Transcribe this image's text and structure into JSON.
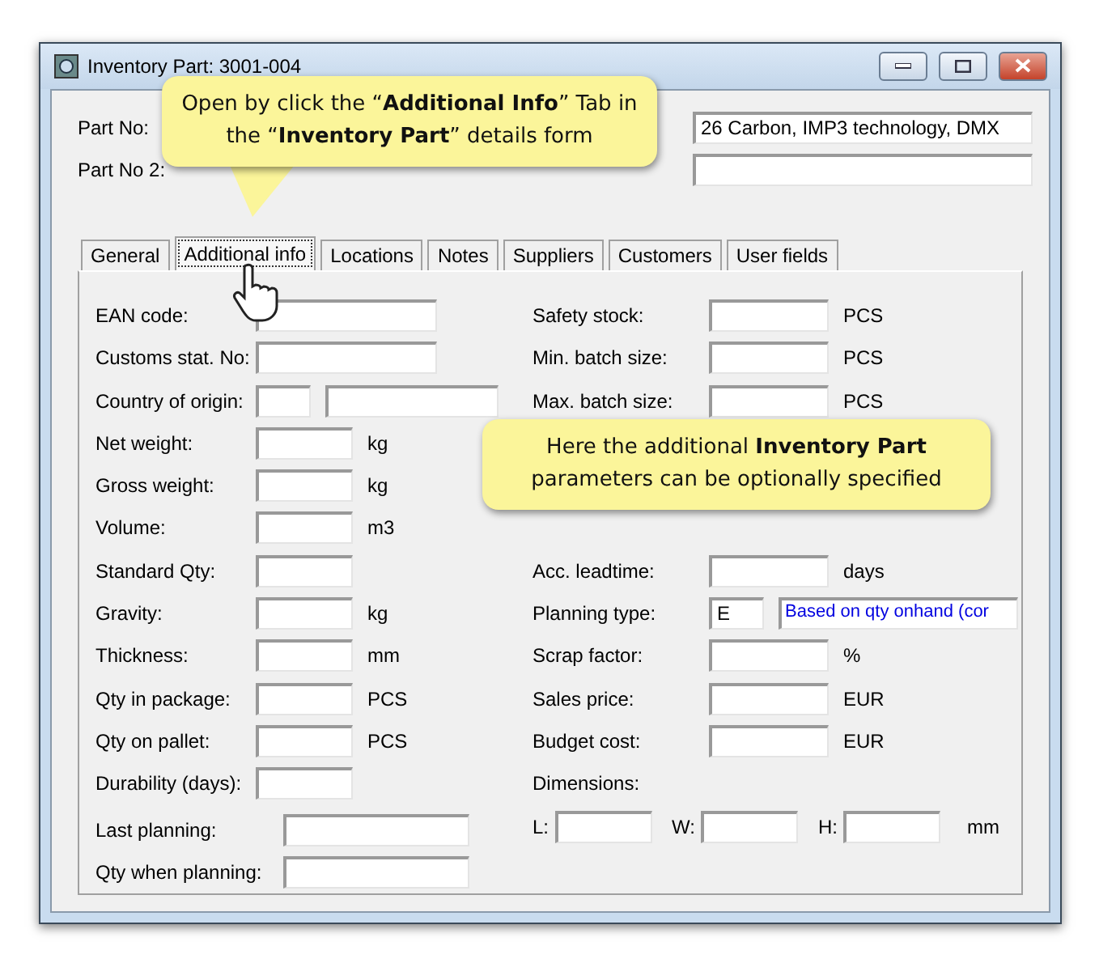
{
  "window": {
    "title": "Inventory Part: 3001-004"
  },
  "header_fields": [
    {
      "label": "Part No:",
      "value": "26 Carbon, IMP3 technology, DMX"
    },
    {
      "label": "Part No 2:"
    }
  ],
  "tabs": [
    {
      "label": "General",
      "selected": false
    },
    {
      "label": "Additional info",
      "selected": true
    },
    {
      "label": "Locations",
      "selected": false
    },
    {
      "label": "Notes",
      "selected": false
    },
    {
      "label": "Suppliers",
      "selected": false
    },
    {
      "label": "Customers",
      "selected": false
    },
    {
      "label": "User fields",
      "selected": false
    }
  ],
  "left_fields": [
    {
      "label": "EAN code:",
      "kind": "long"
    },
    {
      "label": "Customs stat. No:",
      "kind": "long"
    },
    {
      "label": "Country of origin:",
      "kind": "pair"
    },
    {
      "label": "Net weight:",
      "kind": "short",
      "unit": "kg"
    },
    {
      "label": "Gross weight:",
      "kind": "short",
      "unit": "kg"
    },
    {
      "label": "Volume:",
      "kind": "short",
      "unit": "m3"
    },
    {
      "label": "Standard Qty:",
      "kind": "short"
    },
    {
      "label": "Gravity:",
      "kind": "short",
      "unit": "kg"
    },
    {
      "label": "Thickness:",
      "kind": "short",
      "unit": "mm"
    },
    {
      "label": "Qty in package:",
      "kind": "short",
      "unit": "PCS"
    },
    {
      "label": "Qty on pallet:",
      "kind": "short",
      "unit": "PCS"
    },
    {
      "label": "Durability (days):",
      "kind": "short"
    },
    {
      "label": "Last planning:",
      "kind": "wide"
    },
    {
      "label": "Qty when planning:",
      "kind": "wide"
    }
  ],
  "right_fields": [
    {
      "label": "Safety stock:",
      "kind": "short",
      "unit": "PCS"
    },
    {
      "label": "Min. batch size:",
      "kind": "short",
      "unit": "PCS"
    },
    {
      "label": "Max. batch size:",
      "kind": "short",
      "unit": "PCS"
    },
    {
      "label": "Acc. leadtime:",
      "kind": "short",
      "unit": "days"
    },
    {
      "label": "Planning type:",
      "kind": "code",
      "value": "E",
      "description": "Based on qty onhand (cor"
    },
    {
      "label": "Scrap factor:",
      "kind": "short",
      "unit": "%"
    },
    {
      "label": "Sales price:",
      "kind": "short",
      "unit": "EUR"
    },
    {
      "label": "Budget cost:",
      "kind": "short",
      "unit": "EUR"
    }
  ],
  "dimensions": {
    "label": "Dimensions:",
    "items": [
      {
        "label": "L:"
      },
      {
        "label": "W:"
      },
      {
        "label": "H:"
      }
    ],
    "unit": "mm"
  },
  "callouts": [
    {
      "kind": "tab",
      "text": "Open by click the “**Additional  Info**” Tab in the “**Inventory Part**” details form"
    },
    {
      "kind": "panel",
      "text": "Here the additional **Inventory Part** parameters can be optionally specified"
    }
  ]
}
